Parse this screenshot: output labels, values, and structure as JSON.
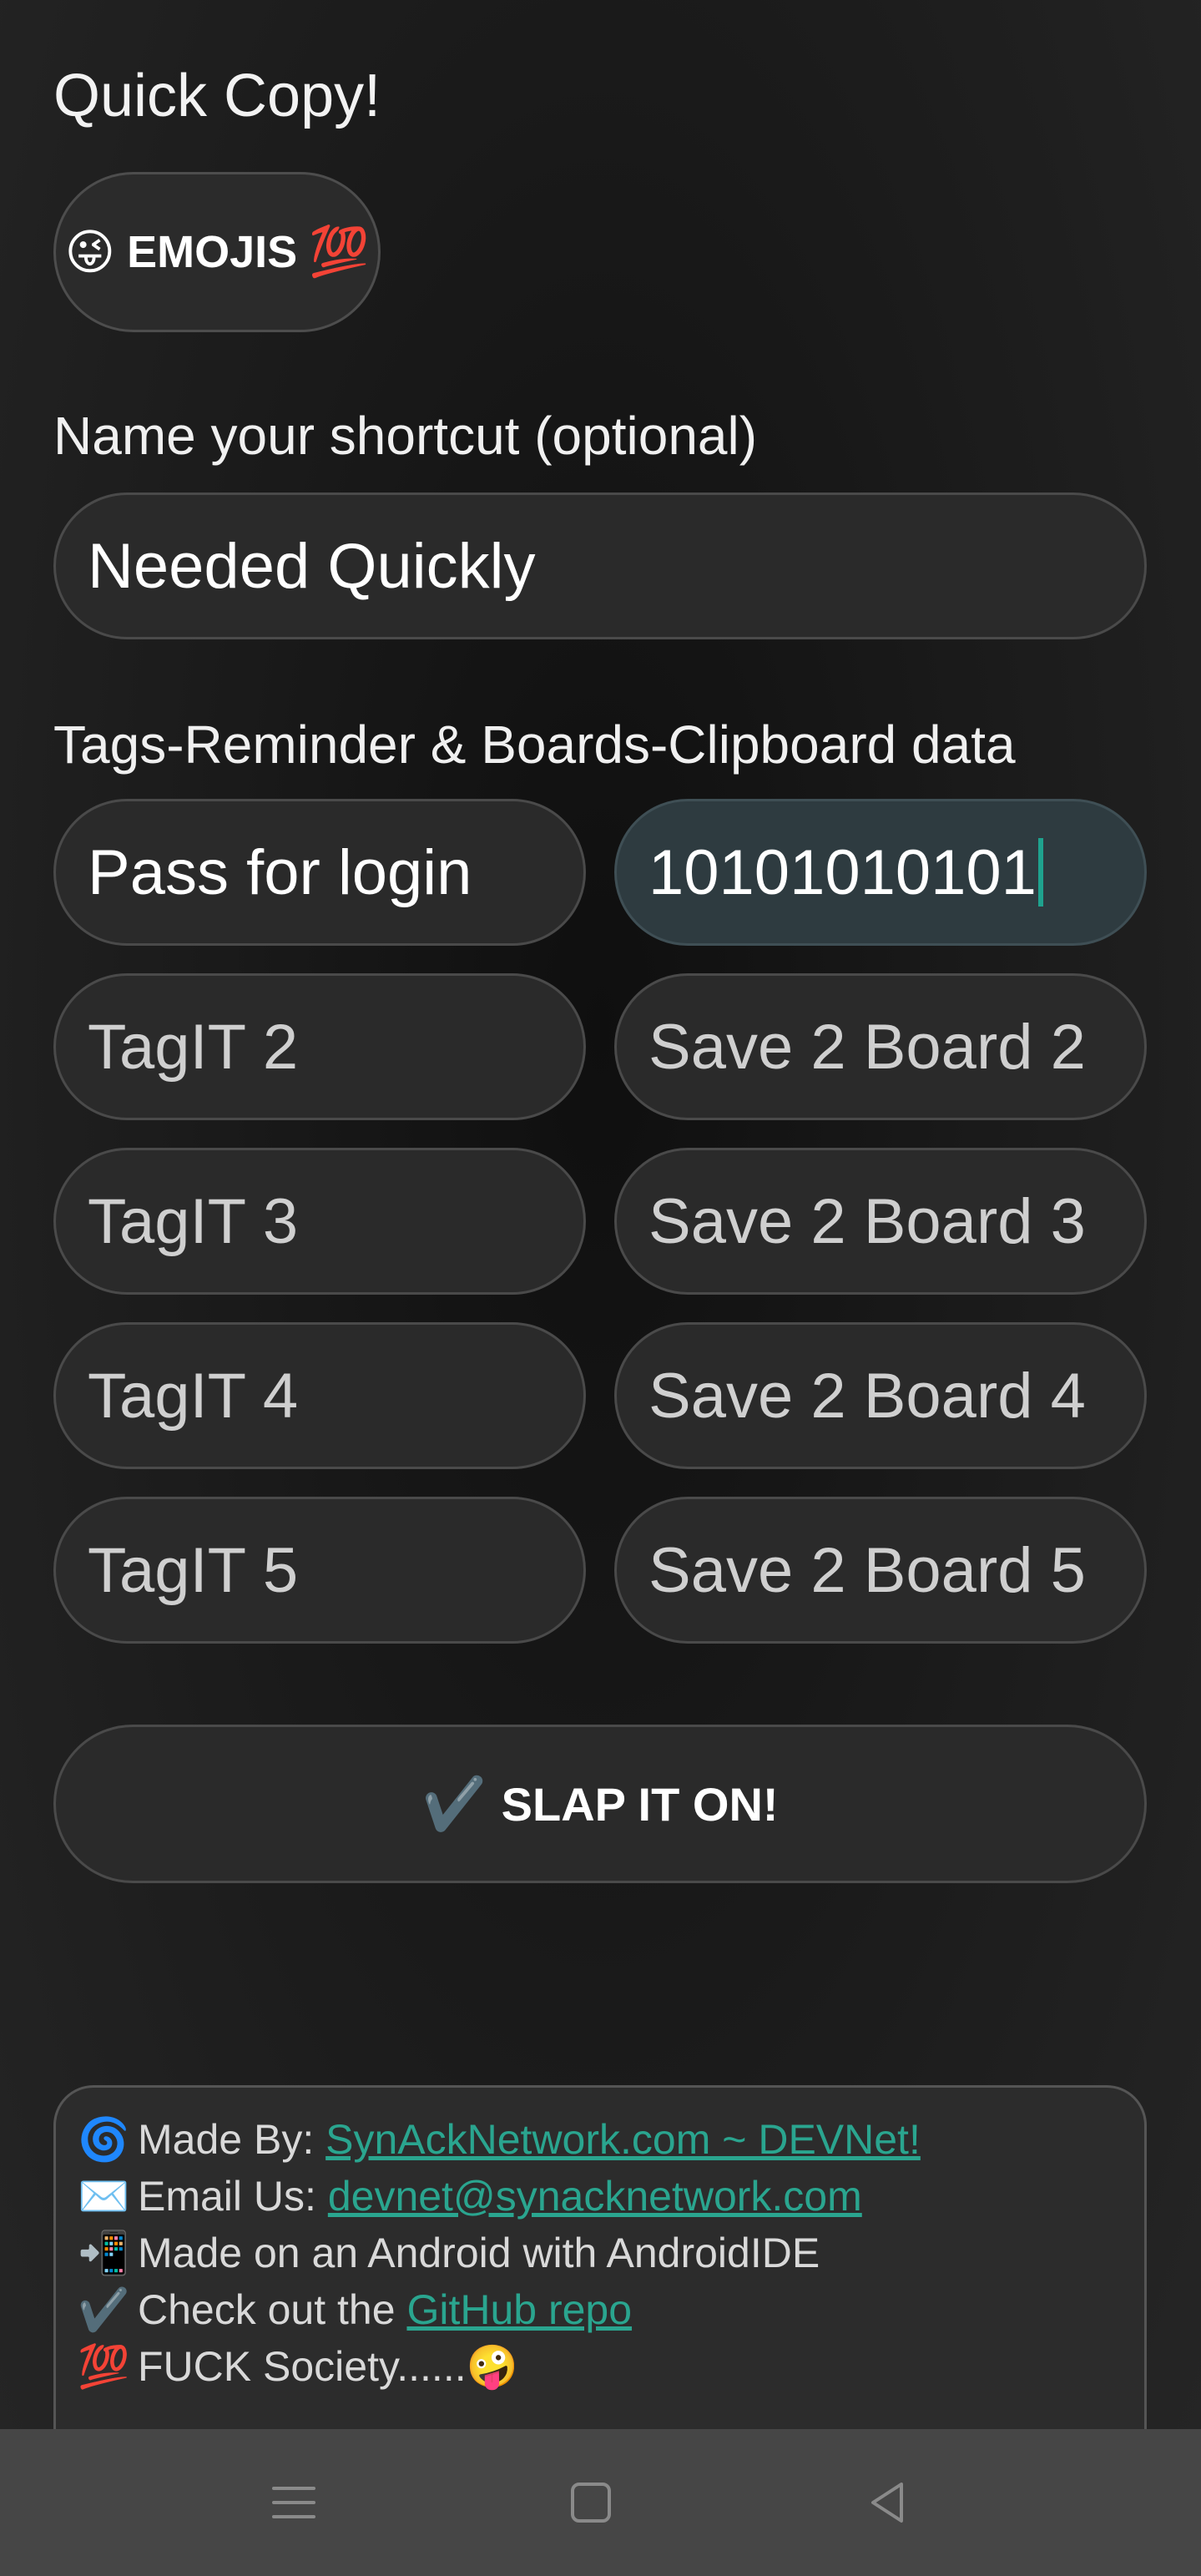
{
  "app": {
    "title": "Quick Copy!"
  },
  "emoji_button": {
    "emoji_left": "😜",
    "label": "EMOJIS",
    "emoji_right": "💯"
  },
  "shortcut": {
    "label": "Name your shortcut (optional)",
    "value": "Needed Quickly"
  },
  "boards": {
    "label": "Tags-Reminder & Boards-Clipboard data",
    "rows": [
      {
        "tag_value": "Pass for login",
        "board_value": "10101010101"
      },
      {
        "tag_placeholder": "TagIT 2",
        "board_placeholder": "Save 2 Board 2"
      },
      {
        "tag_placeholder": "TagIT 3",
        "board_placeholder": "Save 2 Board 3"
      },
      {
        "tag_placeholder": "TagIT 4",
        "board_placeholder": "Save 2 Board 4"
      },
      {
        "tag_placeholder": "TagIT 5",
        "board_placeholder": "Save 2 Board 5"
      }
    ]
  },
  "submit": {
    "icon": "✔️",
    "label": "SLAP IT ON!"
  },
  "footer": {
    "made_by_icon": "🌀",
    "made_by_label": "Made By:",
    "made_by_link": "SynAckNetwork.com ~ DEVNet!",
    "email_icon": "✉️",
    "email_label": "Email Us:",
    "email_link": "devnet@synacknetwork.com",
    "android_icon": "📲",
    "android_text": "Made on an Android with AndroidIDE",
    "github_icon": "✔️",
    "github_label": "Check out the",
    "github_link": "GitHub repo",
    "society_icon": "💯",
    "society_text": "FUCK Society......",
    "society_emoji": "🤪"
  },
  "nav": {
    "icons": [
      "menu-icon",
      "home-square-icon",
      "back-triangle-icon"
    ]
  },
  "colors": {
    "accent_link": "#2aa58f",
    "focused_field_bg": "#2e3b40",
    "caret": "#1fa28e",
    "nav_bar_bg": "#464646"
  }
}
